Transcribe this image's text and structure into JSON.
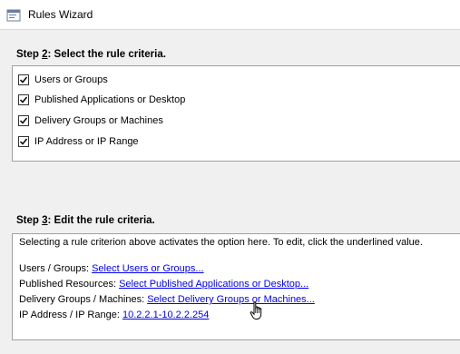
{
  "window": {
    "title": "Rules Wizard",
    "title_icon": "rules-wizard-icon"
  },
  "step2": {
    "prefix": "Step ",
    "number": "2",
    "text": ": Select the rule criteria.",
    "criteria": [
      {
        "label": "Users or Groups",
        "checked": true
      },
      {
        "label": "Published Applications or Desktop",
        "checked": true
      },
      {
        "label": "Delivery Groups or Machines",
        "checked": true
      },
      {
        "label": "IP Address or IP Range",
        "checked": true
      }
    ]
  },
  "step3": {
    "prefix": "Step ",
    "number": "3",
    "text": ": Edit the rule criteria.",
    "instructions": "Selecting a rule criterion above activates the option here. To edit, click the underlined value.",
    "rows": [
      {
        "label": "Users / Groups: ",
        "link": "Select Users or Groups..."
      },
      {
        "label": "Published Resources: ",
        "link": "Select Published Applications or Desktop..."
      },
      {
        "label": "Delivery Groups / Machines: ",
        "link": "Select Delivery Groups or Machines..."
      },
      {
        "label": "IP Address / IP Range: ",
        "link": "10.2.2.1-10.2.2.254"
      }
    ]
  },
  "colors": {
    "link": "#0000ee",
    "background": "#f0f0f0",
    "panel": "#ffffff"
  }
}
